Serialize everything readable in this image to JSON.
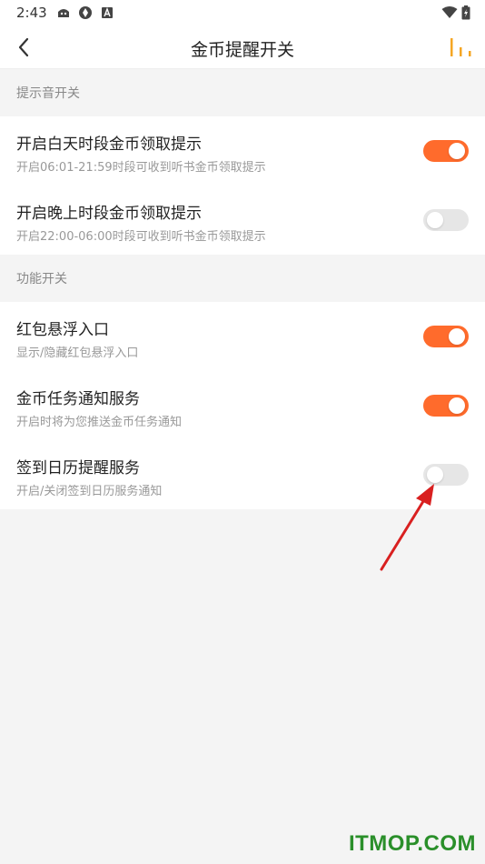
{
  "status_bar": {
    "time": "2:43"
  },
  "nav": {
    "title": "金币提醒开关"
  },
  "sections": [
    {
      "header": "提示音开关",
      "items": [
        {
          "title": "开启白天时段金币领取提示",
          "subtitle": "开启06:01-21:59时段可收到听书金币领取提示",
          "enabled": true
        },
        {
          "title": "开启晚上时段金币领取提示",
          "subtitle": "开启22:00-06:00时段可收到听书金币领取提示",
          "enabled": false
        }
      ]
    },
    {
      "header": "功能开关",
      "items": [
        {
          "title": "红包悬浮入口",
          "subtitle": "显示/隐藏红包悬浮入口",
          "enabled": true
        },
        {
          "title": "金币任务通知服务",
          "subtitle": "开启时将为您推送金币任务通知",
          "enabled": true
        },
        {
          "title": "签到日历提醒服务",
          "subtitle": "开启/关闭签到日历服务通知",
          "enabled": false
        }
      ]
    }
  ],
  "colors": {
    "accent": "#ff6b2c",
    "toggle_off": "#e6e6e6",
    "chart_icon": "#f5a623",
    "annotation_arrow": "#d92020",
    "watermark": "#2a8f2a"
  },
  "watermark": "ITMOP.COM"
}
